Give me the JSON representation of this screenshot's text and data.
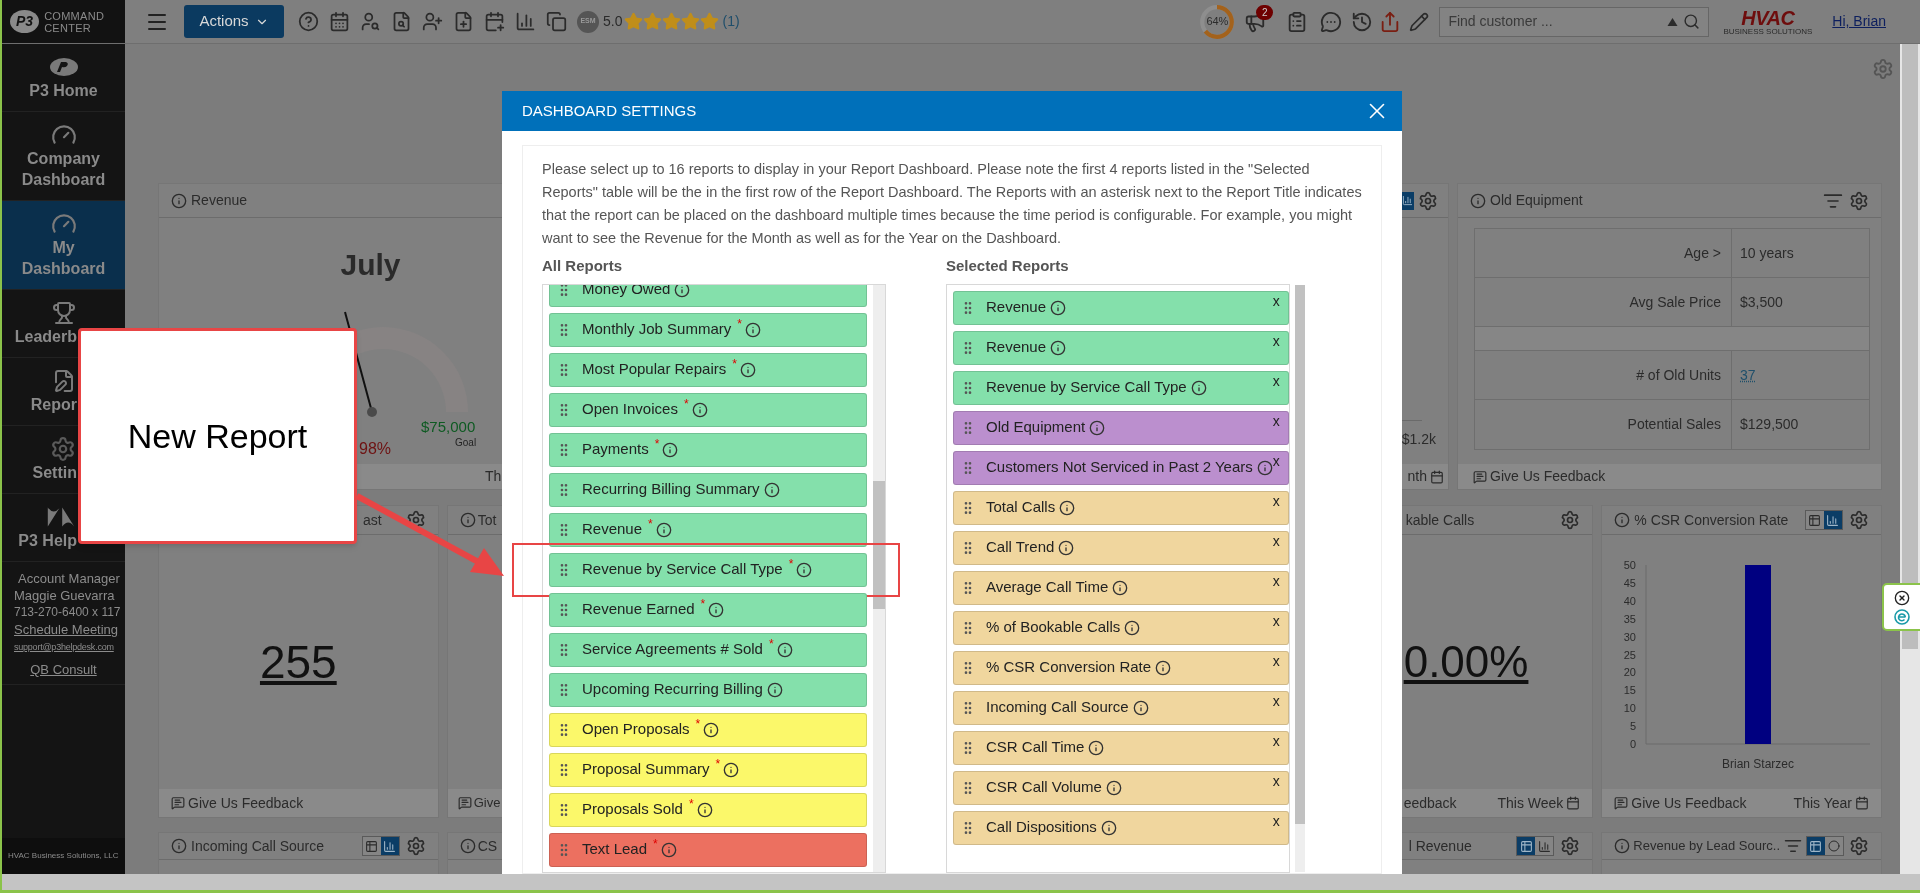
{
  "topbar": {
    "logo": {
      "mark": "P3",
      "line1": "COMMAND",
      "line2": "CENTER"
    },
    "actions": "Actions",
    "esm": "ESM",
    "rating": "5.0",
    "stars": 5,
    "reviews": "(1)",
    "completion": {
      "reading": "64%",
      "level": 0.64
    },
    "alerts": "2",
    "search": {
      "placeholder": "Find customer ..."
    },
    "brand": {
      "name": "HVAC",
      "tagline": "BUSINESS SOLUTIONS"
    },
    "greeting": "Hi, Brian"
  },
  "sidebar": {
    "items": [
      {
        "label": "P3 Home",
        "selected": false
      },
      {
        "label": "Company Dashboard",
        "selected": false
      },
      {
        "label": "My Dashboard",
        "selected": true
      },
      {
        "label": "Leaderb",
        "selected": false
      },
      {
        "label": "Repor",
        "selected": false
      },
      {
        "label": "Settin",
        "selected": false
      },
      {
        "label": "P3 Help",
        "selected": false
      }
    ],
    "account": {
      "title": "Account Manager",
      "name": "Maggie Guevarra",
      "phone": "713-270-6400 x 117",
      "schedule": "Schedule Meeting",
      "email": "support@p3helpdesk.com",
      "consult": "QB Consult"
    },
    "footer": "HVAC Business Solutions, LLC"
  },
  "dashboard": {
    "revenue": {
      "title": "Revenue",
      "month": "July",
      "goal": "$75,000",
      "goal_label": "Goal",
      "percent": "98%",
      "footer": "Th"
    },
    "row1_card3": {
      "chart_selected": true,
      "axis_label": "$1.2k",
      "footer": "nth"
    },
    "old_equipment": {
      "title": "Old Equipment",
      "rows_top": [
        {
          "label": "Age >",
          "value": "10 years"
        },
        {
          "label": "Avg Sale Price",
          "value": "$3,500"
        }
      ],
      "rows_bottom": [
        {
          "label": "# of Old Units",
          "value": "37"
        },
        {
          "label": "Potential Sales",
          "value": "$129,500"
        }
      ],
      "feedback": "Give Us Feedback"
    },
    "row2_card1": {
      "title": "ast",
      "value": "255",
      "feedback": "Give Us Feedback"
    },
    "row2_card2": {
      "title": "Tot",
      "feedback": "Give"
    },
    "row2_card5": {
      "title": "kable Calls",
      "value": "0.00%",
      "feedback": "eedback",
      "period": "This Week"
    },
    "csr": {
      "title": "% CSR Conversion Rate",
      "chart_selected": true,
      "feedback": "Give Us Feedback",
      "period": "This Year",
      "chart_data": {
        "type": "bar",
        "categories": [
          "Brian Starzec"
        ],
        "series": [
          {
            "color": "#000080",
            "values": [
              50
            ]
          }
        ],
        "ylim": [
          0,
          50
        ],
        "yticks": [
          0,
          5,
          10,
          15,
          20,
          25,
          30,
          35,
          40,
          45,
          50
        ]
      }
    },
    "incoming": {
      "title": "Incoming Call Source",
      "chart_selected": true
    },
    "row3_card2": {
      "title": "CS"
    },
    "row3_card5": {
      "title": "l Revenue",
      "chart_selected": false
    },
    "lead_source": {
      "title": "Revenue by Lead Sourc..",
      "chart_selected": false
    }
  },
  "dialog": {
    "title": "DASHBOARD SETTINGS",
    "intro": "Please select up to 16 reports to display in your Report Dashboard. Please note the first 4 reports listed in the \"Selected Reports\" table will be the in the first row of the Report Dashboard. The Reports with an asterisk next to the Report Title indicates that the report can be placed on the dashboard multiple times because the time period is configurable. For example, you might want to see the Revenue for the Month as well as for the Year on the Dashboard.",
    "all_reports": {
      "heading": "All Reports",
      "items": [
        {
          "name": "Money Owed",
          "color": "#84e0ab",
          "highlighted": false
        },
        {
          "name": "Monthly Job Summary",
          "marker": "*",
          "color": "#84e0ab",
          "highlighted": false
        },
        {
          "name": "Most Popular Repairs",
          "marker": "*",
          "color": "#84e0ab",
          "highlighted": false
        },
        {
          "name": "Open Invoices",
          "marker": "*",
          "color": "#84e0ab",
          "highlighted": false
        },
        {
          "name": "Payments",
          "marker": "*",
          "color": "#84e0ab",
          "highlighted": false
        },
        {
          "name": "Recurring Billing Summary",
          "color": "#84e0ab",
          "highlighted": false
        },
        {
          "name": "Revenue",
          "marker": "*",
          "color": "#84e0ab",
          "highlighted": false
        },
        {
          "name": "Revenue by Service Call Type",
          "marker": "*",
          "color": "#84e0ab",
          "highlighted": true
        },
        {
          "name": "Revenue Earned",
          "marker": "*",
          "color": "#84e0ab",
          "highlighted": false
        },
        {
          "name": "Service Agreements # Sold",
          "marker": "*",
          "color": "#84e0ab",
          "highlighted": false
        },
        {
          "name": "Upcoming Recurring Billing",
          "color": "#84e0ab",
          "highlighted": false
        },
        {
          "name": "Open Proposals",
          "marker": "*",
          "color": "#fbf86a",
          "highlighted": false
        },
        {
          "name": "Proposal Summary",
          "marker": "*",
          "color": "#fbf86a",
          "highlighted": false
        },
        {
          "name": "Proposals Sold",
          "marker": "*",
          "color": "#fbf86a",
          "highlighted": false
        },
        {
          "name": "Text Lead",
          "marker": "*",
          "color": "#ec7060",
          "highlighted": false
        }
      ]
    },
    "selected_reports": {
      "heading": "Selected Reports",
      "items": [
        {
          "name": "Revenue",
          "remove": "x",
          "color": "#84e0ab"
        },
        {
          "name": "Revenue",
          "remove": "x",
          "color": "#84e0ab"
        },
        {
          "name": "Revenue by Service Call Type",
          "remove": "x",
          "color": "#84e0ab"
        },
        {
          "name": "Old Equipment",
          "remove": "x",
          "color": "#bb8fce"
        },
        {
          "name": "Customers Not Serviced in Past 2 Years",
          "remove": "x",
          "color": "#bb8fce"
        },
        {
          "name": "Total Calls",
          "remove": "x",
          "color": "#f0d69e"
        },
        {
          "name": "Call Trend",
          "remove": "x",
          "color": "#f0d69e"
        },
        {
          "name": "Average Call Time",
          "remove": "x",
          "color": "#f0d69e"
        },
        {
          "name": "% of Bookable Calls",
          "remove": "x",
          "color": "#f0d69e"
        },
        {
          "name": "% CSR Conversion Rate",
          "remove": "x",
          "color": "#f0d69e"
        },
        {
          "name": "Incoming Call Source",
          "remove": "x",
          "color": "#f0d69e"
        },
        {
          "name": "CSR Call Time",
          "remove": "x",
          "color": "#f0d69e"
        },
        {
          "name": "CSR Call Volume",
          "remove": "x",
          "color": "#f0d69e"
        },
        {
          "name": "Call Dispositions",
          "remove": "x",
          "color": "#f0d69e"
        }
      ]
    }
  },
  "callout": {
    "text": "New Report"
  }
}
